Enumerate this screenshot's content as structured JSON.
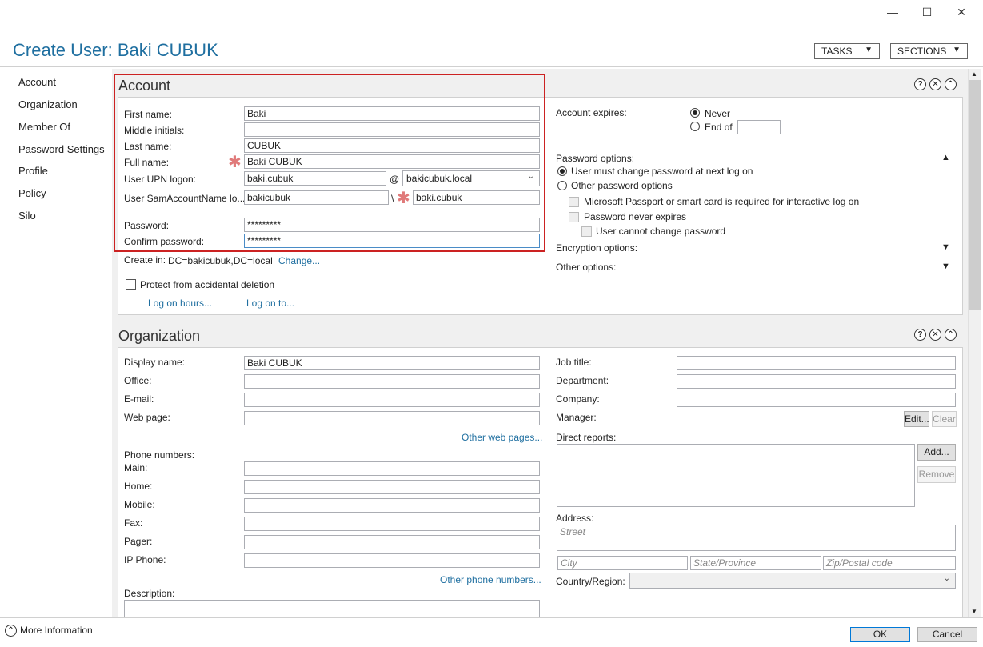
{
  "window": {
    "title": "Create User: Baki CUBUK",
    "min": "—",
    "max": "☐",
    "close": "✕"
  },
  "header": {
    "tasks_label": "TASKS",
    "sections_label": "SECTIONS"
  },
  "sidebar": {
    "items": [
      "Account",
      "Organization",
      "Member Of",
      "Password Settings",
      "Profile",
      "Policy",
      "Silo"
    ]
  },
  "account": {
    "title": "Account",
    "first_name_label": "First name:",
    "first_name": "Baki",
    "middle_label": "Middle initials:",
    "middle": "",
    "last_name_label": "Last name:",
    "last_name": "CUBUK",
    "full_name_label": "Full name:",
    "full_name": "Baki CUBUK",
    "upn_label": "User UPN logon:",
    "upn": "baki.cubuk",
    "at": "@",
    "upn_domain": "bakicubuk.local",
    "sam_label": "User SamAccountName lo...",
    "sam_domain": "bakicubuk",
    "backslash": "\\",
    "sam": "baki.cubuk",
    "password_label": "Password:",
    "password": "*********",
    "confirm_label": "Confirm password:",
    "confirm": "*********",
    "create_in_label": "Create in:",
    "create_in": "DC=bakicubuk,DC=local",
    "change_link": "Change...",
    "protect_label": "Protect from accidental deletion",
    "logon_hours_link": "Log on hours...",
    "logon_to_link": "Log on to...",
    "expires_label": "Account expires:",
    "never_label": "Never",
    "end_of_label": "End of",
    "password_options_label": "Password options:",
    "must_change_label": "User must change password at next log on",
    "other_pw_label": "Other password options",
    "smartcard_label": "Microsoft Passport or smart card is required for interactive log on",
    "never_expires_label": "Password never expires",
    "cannot_change_label": "User cannot change password",
    "encryption_label": "Encryption options:",
    "other_options_label": "Other options:"
  },
  "organization": {
    "title": "Organization",
    "display_name_label": "Display name:",
    "display_name": "Baki CUBUK",
    "office_label": "Office:",
    "email_label": "E-mail:",
    "web_label": "Web page:",
    "other_web_link": "Other web pages...",
    "phone_label": "Phone numbers:",
    "main_label": "Main:",
    "home_label": "Home:",
    "mobile_label": "Mobile:",
    "fax_label": "Fax:",
    "pager_label": "Pager:",
    "ip_label": "IP Phone:",
    "other_phone_link": "Other phone numbers...",
    "description_label": "Description:",
    "job_label": "Job title:",
    "dept_label": "Department:",
    "company_label": "Company:",
    "manager_label": "Manager:",
    "edit_label": "Edit...",
    "clear_label": "Clear",
    "reports_label": "Direct reports:",
    "add_label": "Add...",
    "remove_label": "Remove",
    "address_label": "Address:",
    "street_ph": "Street",
    "city_ph": "City",
    "state_ph": "State/Province",
    "zip_ph": "Zip/Postal code",
    "country_label": "Country/Region:"
  },
  "footer": {
    "more_info": "More Information",
    "ok_label": "OK",
    "cancel_label": "Cancel"
  }
}
